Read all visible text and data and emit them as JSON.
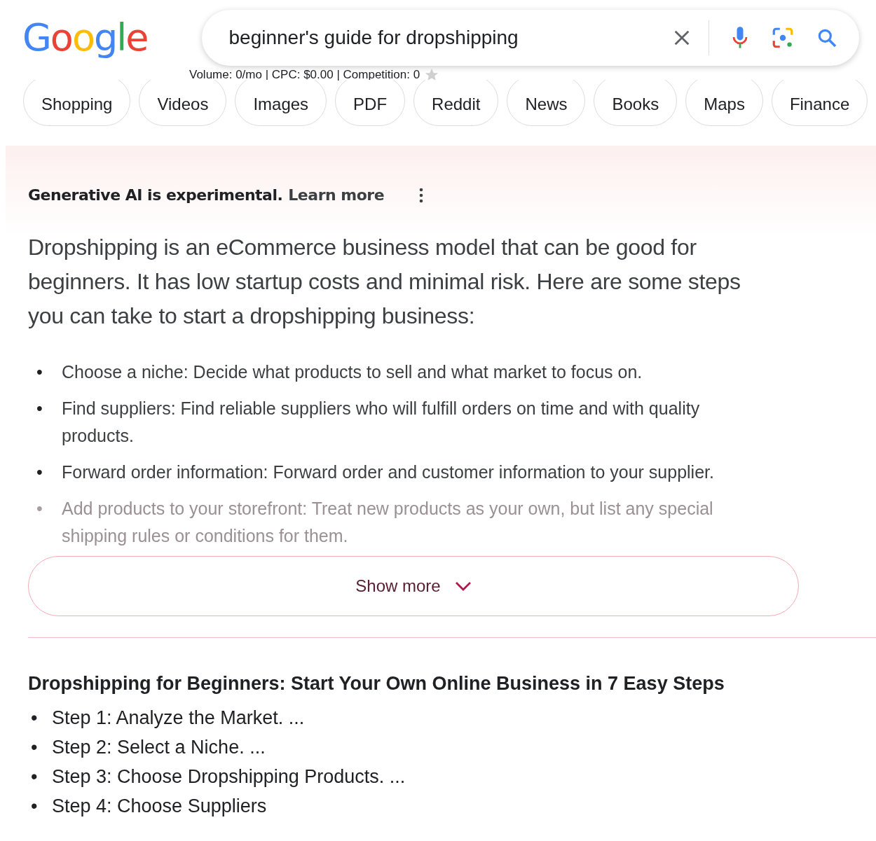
{
  "logo": "Google",
  "search": {
    "value": "beginner's guide for dropshipping"
  },
  "seo_stats": "Volume: 0/mo | CPC: $0.00 | Competition: 0",
  "chips": [
    {
      "label": "Shopping"
    },
    {
      "label": "Videos"
    },
    {
      "label": "Images"
    },
    {
      "label": "PDF"
    },
    {
      "label": "Reddit"
    },
    {
      "label": "News"
    },
    {
      "label": "Books"
    },
    {
      "label": "Maps"
    },
    {
      "label": "Finance"
    }
  ],
  "ai_overview": {
    "notice": "Generative AI is experimental.",
    "learn_more": "Learn more",
    "summary": "Dropshipping is an eCommerce business model that can be good for beginners. It has low startup costs and minimal risk. Here are some steps you can take to start a dropshipping business:",
    "steps": [
      {
        "bullet": "•",
        "text": "Choose a niche: Decide what products to sell and what market to focus on.",
        "faded": false
      },
      {
        "bullet": "•",
        "text": "Find suppliers: Find reliable suppliers who will fulfill orders on time and with quality products.",
        "faded": false
      },
      {
        "bullet": "•",
        "text": "Forward order information: Forward order and customer information to your supplier.",
        "faded": false
      },
      {
        "bullet": "•",
        "text": "Add products to your storefront: Treat new products as your own, but list any special shipping rules or conditions for them.",
        "faded": true
      }
    ],
    "show_more": "Show more"
  },
  "snippet": {
    "title": "Dropshipping for Beginners: Start Your Own Online Business in 7 Easy Steps",
    "items": [
      {
        "bullet": "•",
        "text": "Step 1: Analyze the Market. ..."
      },
      {
        "bullet": "•",
        "text": "Step 2: Select a Niche. ..."
      },
      {
        "bullet": "•",
        "text": "Step 3: Choose Dropshipping Products. ..."
      },
      {
        "bullet": "•",
        "text": "Step 4: Choose Suppliers"
      }
    ]
  }
}
